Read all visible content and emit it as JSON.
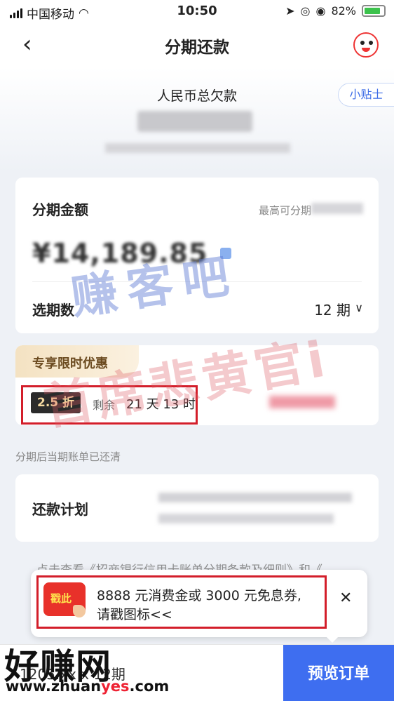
{
  "status_bar": {
    "carrier": "中国移动",
    "time": "10:50",
    "battery": "82%"
  },
  "nav": {
    "title": "分期还款"
  },
  "summary": {
    "total_label": "人民币总欠款",
    "tips_label": "小贴士"
  },
  "installment": {
    "amount_label": "分期金额",
    "max_label": "最高可分期",
    "amount_value": "¥14,189.85",
    "period_label": "选期数",
    "period_value": "12 期"
  },
  "promo": {
    "title": "专享限时优惠",
    "discount": "2.5 折",
    "remaining_label": "剩余",
    "countdown": "21 天 13 时"
  },
  "note": "分期后当期账单已还清",
  "plan": {
    "label": "还款计划"
  },
  "legal_text": "点击查看《招商银行信用卡账单分期条款及细则》和《",
  "popup": {
    "icon_label": "戳此",
    "line1": "8888 元消费金或 3000 元免息券,",
    "line2": "请戳图标<<"
  },
  "bottom_bar": {
    "summary": "1205.xx x 12期",
    "preview_button": "预览订单"
  },
  "watermarks": {
    "top": "赚客吧",
    "bottom": "首席悲黄官i"
  },
  "site_logo": {
    "name": "好赚网",
    "url_prefix": "www.zhuan",
    "url_highlight": "yes",
    "url_suffix": ".com"
  },
  "colors": {
    "accent": "#3e6ef0",
    "highlight": "#d31e2a",
    "promo_gold": "#6b4a1f"
  }
}
